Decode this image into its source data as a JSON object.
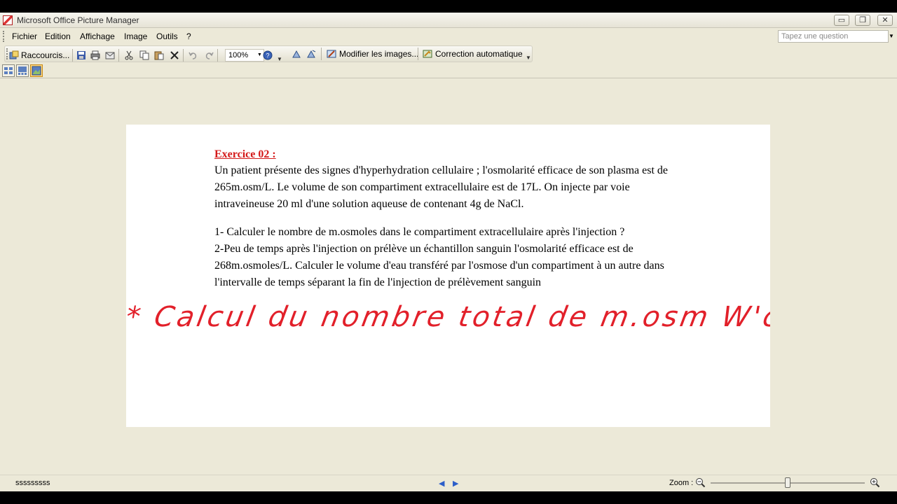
{
  "window": {
    "title": "Microsoft Office Picture Manager",
    "buttons": {
      "minimize": "▭",
      "restore": "❐",
      "close": "✕"
    }
  },
  "menu": {
    "items": [
      "Fichier",
      "Edition",
      "Affichage",
      "Image",
      "Outils",
      "?"
    ],
    "ask_placeholder": "Tapez une question"
  },
  "toolbar": {
    "shortcuts_label": "Raccourcis...",
    "zoom_value": "100%",
    "edit_images_label": "Modifier les images...",
    "auto_correct_label": "Correction automatique"
  },
  "document": {
    "heading": "Exercice 02 :",
    "paragraph1": "Un patient présente des signes d'hyperhydration cellulaire ;   l'osmolarité efficace  de son plasma est de 265m.osm/L. Le volume de son compartiment extracellulaire est de  17L. On injecte  par voie intraveineuse 20 ml   d'une solution aqueuse de   contenant 4g de NaCl.",
    "question1": "1- Calculer le  nombre de m.osmoles dans le compartiment extracellulaire après  l'injection ?",
    "question2": "2-Peu de temps après l'injection on prélève un échantillon sanguin l'osmolarité efficace  est de 268m.osmoles/L. Calculer le volume d'eau transféré par l'osmose d'un compartiment à un autre dans l'intervalle de temps séparant la fin de l'injection de prélèvement sanguin",
    "handwritten": "* Calcul du nombre total de m.osm W'c"
  },
  "status": {
    "filename": "sssssssss",
    "zoom_label": "Zoom :",
    "zoom_level": 0.5
  },
  "colors": {
    "heading": "#d41a1a",
    "handwriting": "#e2202a",
    "chrome": "#ece9d8"
  }
}
